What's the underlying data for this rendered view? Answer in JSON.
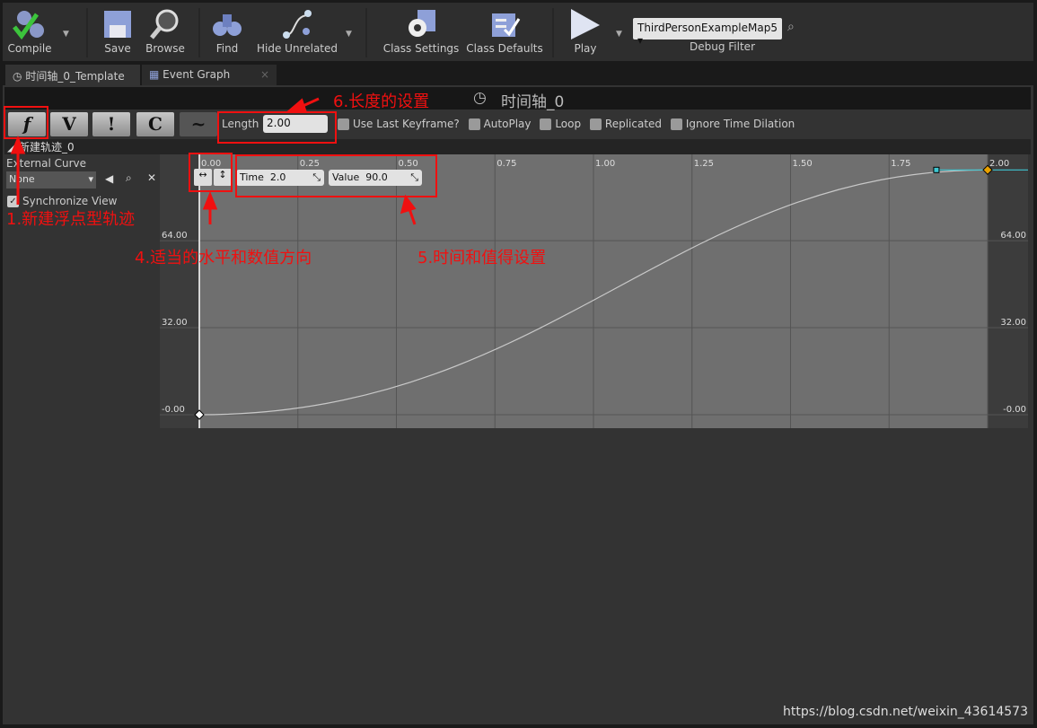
{
  "toolbar": {
    "compile": "Compile",
    "save": "Save",
    "browse": "Browse",
    "find": "Find",
    "hide_unrelated": "Hide Unrelated",
    "class_settings": "Class Settings",
    "class_defaults": "Class Defaults",
    "play": "Play",
    "debug_select": "ThirdPersonExampleMap5",
    "debug_filter": "Debug Filter"
  },
  "tabs": [
    {
      "label": "时间轴_0_Template",
      "icon": "clock-icon"
    },
    {
      "label": "Event Graph",
      "icon": "graph-icon"
    }
  ],
  "timeline": {
    "title": "时间轴_0",
    "length_label": "Length",
    "length_value": "2.00",
    "options": [
      {
        "label": "Use Last Keyframe?",
        "checked": false
      },
      {
        "label": "AutoPlay",
        "checked": false
      },
      {
        "label": "Loop",
        "checked": false
      },
      {
        "label": "Replicated",
        "checked": false
      },
      {
        "label": "Ignore Time Dilation",
        "checked": false
      }
    ],
    "track_tools": [
      "f",
      "V",
      "!",
      "C"
    ],
    "track_name": "新建轨迹_0",
    "external_curve_label": "External Curve",
    "external_curve_value": "None",
    "sync_view": "Synchronize View",
    "time_label": "Time",
    "time_value": "2.0",
    "value_label": "Value",
    "value_value": "90.0"
  },
  "chart_data": {
    "type": "line",
    "x_ticks": [
      "0.00",
      "0.25",
      "0.50",
      "0.75",
      "1.00",
      "1.25",
      "1.50",
      "1.75",
      "2.00"
    ],
    "y_ticks": [
      "-0.00",
      "32.00",
      "64.00"
    ],
    "xlim": [
      -0.1,
      2.1
    ],
    "ylim": [
      -5,
      95
    ],
    "keys": [
      {
        "x": 0,
        "y": 0
      },
      {
        "x": 2.0,
        "y": 90
      }
    ],
    "curve_color": "#c8c8c8",
    "selected_key_color": "#e8a000",
    "tangent_color": "#3ec6d0"
  },
  "annotations": {
    "a1": "1.新建浮点型轨迹",
    "a4": "4.适当的水平和数值方向",
    "a5": "5.时间和值得设置",
    "a6": "6.长度的设置",
    "color": "#f01010"
  },
  "watermark": "https://blog.csdn.net/weixin_43614573"
}
